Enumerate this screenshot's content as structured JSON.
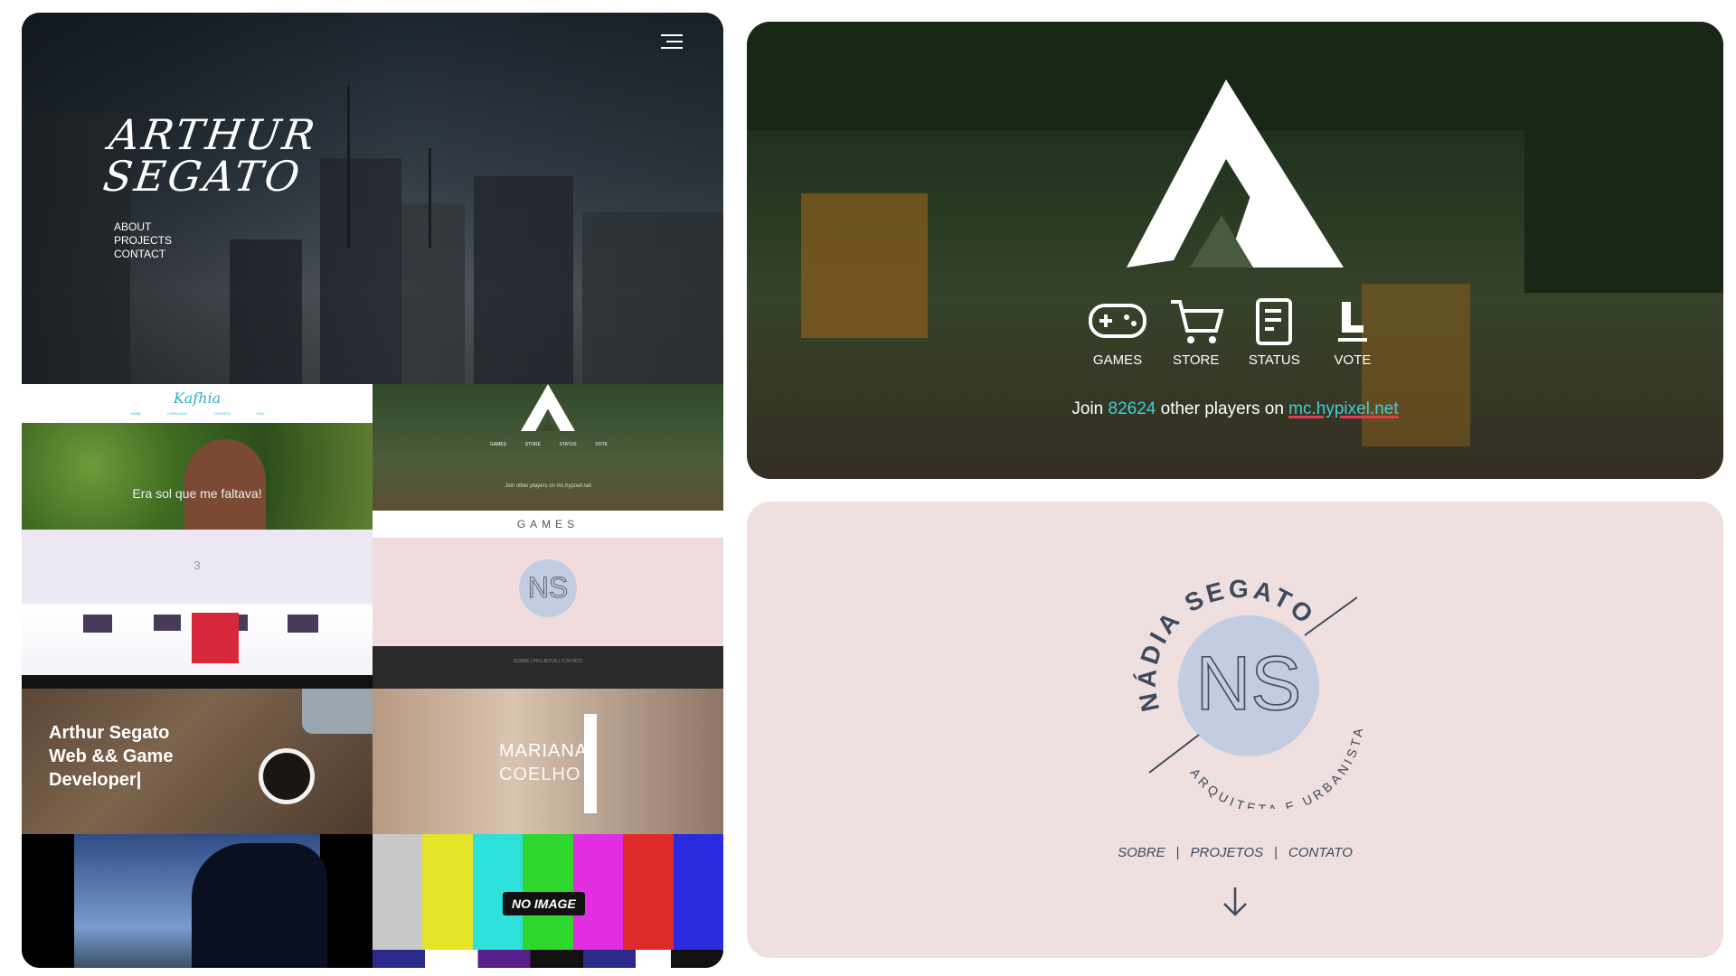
{
  "portfolio": {
    "brand_line1": "ARTHUR",
    "brand_line2": "SEGATO",
    "nav": [
      "ABOUT",
      "PROJECTS",
      "CONTACT"
    ],
    "menu_icon": "hamburger-icon"
  },
  "thumbnails": {
    "kaftia_logo": "Kafhia",
    "kaftia_caption": "Era sol que me faltava!",
    "kaftia_nav": "HOME CATALOGO CONTATO FAQ",
    "hypixel_games_label": "GAMES",
    "game_score": "3",
    "desk_line1": "Arthur Segato",
    "desk_line2": "Web && Game",
    "desk_line3": "Developer|",
    "mariana_line1": "MARIANA",
    "mariana_line2": "COELHO",
    "no_image": "NO IMAGE"
  },
  "hypixel": {
    "nav": [
      {
        "label": "GAMES",
        "icon": "gamepad-icon"
      },
      {
        "label": "STORE",
        "icon": "cart-icon"
      },
      {
        "label": "STATUS",
        "icon": "status-icon"
      },
      {
        "label": "VOTE",
        "icon": "vote-icon"
      }
    ],
    "join_prefix": "Join",
    "player_count": "82624",
    "join_middle": "other players on",
    "server": "mc.hypixel.net",
    "colors": {
      "accent": "#3fd0d7",
      "underline": "#e43b4b"
    }
  },
  "nadia": {
    "name": "SEGATO",
    "first": "NÁDIA",
    "role": "ARQUITETA E URBANISTA",
    "monogram": "NS",
    "nav": [
      "SOBRE",
      "PROJETOS",
      "CONTATO"
    ],
    "separator": "|",
    "arrow_icon": "arrow-down-icon",
    "colors": {
      "background": "#efdfde",
      "circle": "#c3cde1",
      "text": "#3d4a5e"
    }
  }
}
